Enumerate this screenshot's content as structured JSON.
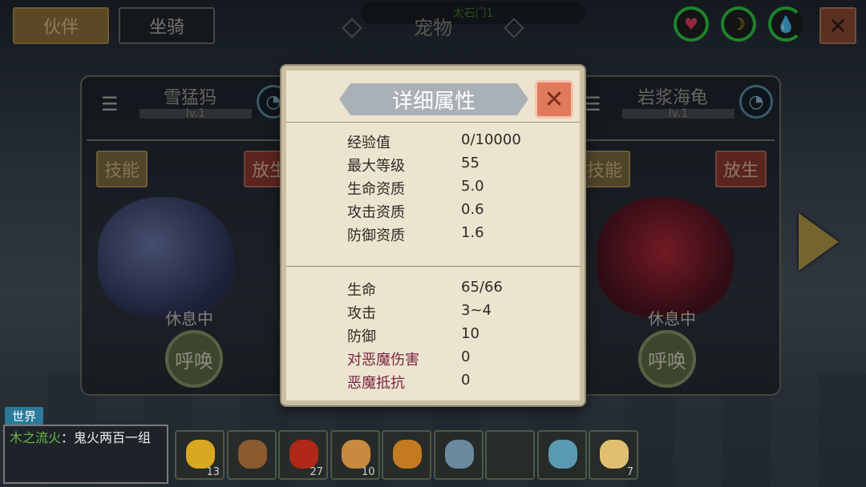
{
  "top_tabs": {
    "active": "伙伴",
    "inactive": "坐骑"
  },
  "screen_title": "宠物",
  "top_center_name": "太石门1",
  "status_icons": [
    "heart-icon",
    "banana-icon",
    "water-drop-icon"
  ],
  "left_pet": {
    "name": "雪猛犸",
    "level": "lv.1",
    "skill": "技能",
    "release": "放生",
    "state": "休息中",
    "summon": "呼唤"
  },
  "right_pet": {
    "name": "岩浆海龟",
    "level": "lv.1",
    "skill": "技能",
    "release": "放生",
    "state": "休息中",
    "summon": "呼唤"
  },
  "dialog": {
    "title": "详细属性",
    "base_attrs": [
      {
        "k": "经验值",
        "v": "0/10000"
      },
      {
        "k": "最大等级",
        "v": "55"
      },
      {
        "k": "生命资质",
        "v": "5.0"
      },
      {
        "k": "攻击资质",
        "v": "0.6"
      },
      {
        "k": "防御资质",
        "v": "1.6"
      }
    ],
    "combat_attrs": [
      {
        "k": "生命",
        "v": "65/66"
      },
      {
        "k": "攻击",
        "v": "3~4"
      },
      {
        "k": "防御",
        "v": "10"
      },
      {
        "k": "对恶魔伤害",
        "v": "0"
      },
      {
        "k": "恶魔抵抗",
        "v": "0"
      }
    ]
  },
  "chat": {
    "channel": "世界",
    "speaker": "木之流火",
    "separator": "：",
    "message": "鬼火两百一组"
  },
  "hotbar": [
    {
      "icon": "banana-item",
      "count": "13",
      "color": "#d8a820"
    },
    {
      "icon": "meat-leg-item",
      "count": "",
      "color": "#8a5a30"
    },
    {
      "icon": "chili-pepper-item",
      "count": "27",
      "color": "#b02818"
    },
    {
      "icon": "dumpling-basket-item",
      "count": "10",
      "color": "#c88a40"
    },
    {
      "icon": "banana-peel-item",
      "count": "",
      "color": "#c47a20"
    },
    {
      "icon": "crystal-sword-item",
      "count": "",
      "color": "#6a8aa0"
    },
    {
      "icon": "empty-slot",
      "count": "",
      "color": "transparent"
    },
    {
      "icon": "crystal-bow-item",
      "count": "",
      "color": "#5a9ab0"
    },
    {
      "icon": "seed-bag-item",
      "count": "7",
      "color": "#e0c070"
    }
  ]
}
